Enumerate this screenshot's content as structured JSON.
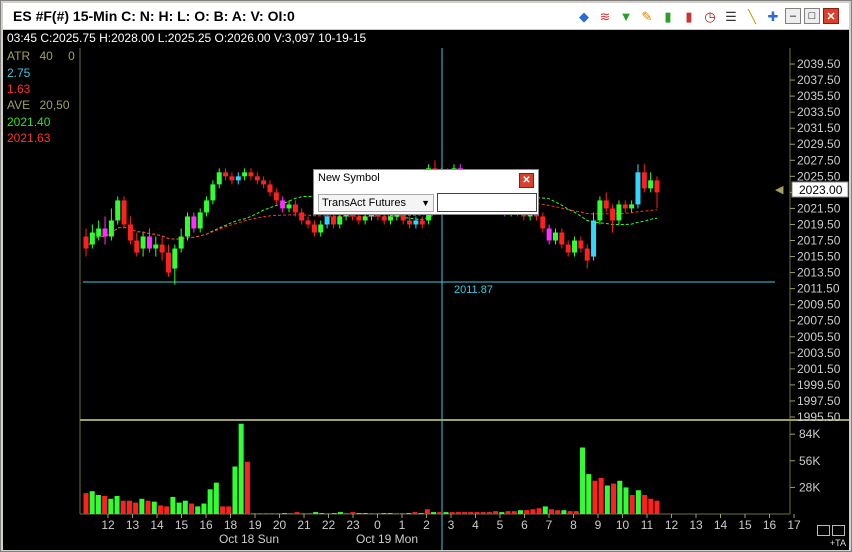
{
  "window": {
    "title": "ES #F(#) 15-Min  C: N: H: L: O: B: A: V: OI:0",
    "toolbar_icons": [
      "diamond-icon",
      "wave-icon",
      "funnel-icon",
      "pencil-icon",
      "bars-icon",
      "candle-icon",
      "clock-icon",
      "list-icon",
      "line-draw-icon",
      "pin-icon"
    ],
    "minimize_label": "–",
    "restore_label": "□",
    "close_label": "✕"
  },
  "infobar": {
    "text": "03:45  C:2025.75  H:2028.00  L:2025.25  O:2026.00  V:3,097  10-19-15"
  },
  "indicators": {
    "atr_label": "ATR",
    "atr_param": "40",
    "atr_extra": "0",
    "atr_val1": "2.75",
    "atr_val2": "1.63",
    "ave_label": "AVE",
    "ave_param": "20,50",
    "ave_val1": "2021.40",
    "ave_val2": "2021.63"
  },
  "price_axis": {
    "labels": [
      "2039.50",
      "2037.50",
      "2035.50",
      "2033.50",
      "2031.50",
      "2029.50",
      "2027.50",
      "2025.50",
      "2023.50",
      "2021.50",
      "2019.50",
      "2017.50",
      "2015.50",
      "2013.50",
      "2011.50",
      "2009.50",
      "2007.50",
      "2005.50",
      "2003.50",
      "2001.50",
      "1999.50",
      "1997.50",
      "1995.50"
    ],
    "current_price": "2023.00",
    "crosshair_price": "2011.87"
  },
  "volume_axis": {
    "labels": [
      "84K",
      "56K",
      "28K"
    ]
  },
  "time_axis": {
    "labels": [
      "12",
      "13",
      "14",
      "15",
      "16",
      "18",
      "19",
      "20",
      "21",
      "22",
      "23",
      "0",
      "1",
      "2",
      "3",
      "4",
      "5",
      "6",
      "7",
      "8",
      "9",
      "10",
      "11",
      "12",
      "13",
      "14",
      "15",
      "16",
      "17"
    ],
    "date_labels": [
      "Oct 18 Sun",
      "Oct 19 Mon"
    ]
  },
  "dialog": {
    "title": "New Symbol",
    "close_label": "✕",
    "select_value": "TransAct Futures",
    "input_value": ""
  },
  "corner": {
    "ta_label": "+TA"
  },
  "chart_data": {
    "type": "candlestick",
    "ylim": [
      1995.5,
      2040.5
    ],
    "candles": [
      {
        "o": 2018.0,
        "c": 2016.5,
        "h": 2019.0,
        "l": 2015.5
      },
      {
        "o": 2017.0,
        "c": 2018.5,
        "h": 2019.5,
        "l": 2016.5
      },
      {
        "o": 2018.0,
        "c": 2019.0,
        "h": 2020.0,
        "l": 2017.5
      },
      {
        "o": 2019.0,
        "c": 2018.0,
        "h": 2020.5,
        "l": 2017.0
      },
      {
        "o": 2018.0,
        "c": 2020.0,
        "h": 2021.5,
        "l": 2017.5
      },
      {
        "o": 2020.0,
        "c": 2022.5,
        "h": 2023.0,
        "l": 2019.5
      },
      {
        "o": 2022.5,
        "c": 2019.5,
        "h": 2023.0,
        "l": 2019.0
      },
      {
        "o": 2019.5,
        "c": 2017.5,
        "h": 2020.5,
        "l": 2017.0
      },
      {
        "o": 2017.5,
        "c": 2016.0,
        "h": 2018.5,
        "l": 2015.5
      },
      {
        "o": 2016.5,
        "c": 2018.0,
        "h": 2018.5,
        "l": 2015.5
      },
      {
        "o": 2018.0,
        "c": 2016.5,
        "h": 2019.0,
        "l": 2016.0
      },
      {
        "o": 2016.5,
        "c": 2017.0,
        "h": 2018.0,
        "l": 2015.5
      },
      {
        "o": 2017.0,
        "c": 2016.0,
        "h": 2018.0,
        "l": 2015.0
      },
      {
        "o": 2016.0,
        "c": 2013.5,
        "h": 2017.0,
        "l": 2013.0
      },
      {
        "o": 2014.0,
        "c": 2016.5,
        "h": 2017.0,
        "l": 2012.0
      },
      {
        "o": 2016.5,
        "c": 2018.0,
        "h": 2019.0,
        "l": 2016.0
      },
      {
        "o": 2018.0,
        "c": 2020.5,
        "h": 2021.0,
        "l": 2017.5
      },
      {
        "o": 2020.5,
        "c": 2019.0,
        "h": 2021.0,
        "l": 2018.5
      },
      {
        "o": 2019.0,
        "c": 2021.0,
        "h": 2021.5,
        "l": 2018.5
      },
      {
        "o": 2021.0,
        "c": 2022.5,
        "h": 2023.0,
        "l": 2020.5
      },
      {
        "o": 2022.5,
        "c": 2024.5,
        "h": 2025.0,
        "l": 2022.0
      },
      {
        "o": 2024.5,
        "c": 2026.0,
        "h": 2026.5,
        "l": 2024.0
      },
      {
        "o": 2026.0,
        "c": 2025.5,
        "h": 2026.5,
        "l": 2025.0
      },
      {
        "o": 2025.5,
        "c": 2025.0,
        "h": 2026.0,
        "l": 2024.5
      },
      {
        "o": 2025.0,
        "c": 2025.5,
        "h": 2026.0,
        "l": 2024.5
      },
      {
        "o": 2025.5,
        "c": 2026.0,
        "h": 2026.5,
        "l": 2025.0
      },
      {
        "o": 2026.0,
        "c": 2025.5,
        "h": 2026.5,
        "l": 2025.0
      },
      {
        "o": 2025.5,
        "c": 2025.0,
        "h": 2026.0,
        "l": 2024.5
      },
      {
        "o": 2025.0,
        "c": 2024.5,
        "h": 2025.5,
        "l": 2024.0
      },
      {
        "o": 2024.5,
        "c": 2023.5,
        "h": 2025.0,
        "l": 2023.0
      },
      {
        "o": 2023.5,
        "c": 2022.5,
        "h": 2024.0,
        "l": 2022.0
      },
      {
        "o": 2022.5,
        "c": 2021.5,
        "h": 2023.0,
        "l": 2021.0
      },
      {
        "o": 2021.5,
        "c": 2022.0,
        "h": 2022.5,
        "l": 2021.0
      },
      {
        "o": 2022.0,
        "c": 2021.0,
        "h": 2022.5,
        "l": 2020.5
      },
      {
        "o": 2021.0,
        "c": 2020.0,
        "h": 2021.5,
        "l": 2019.5
      },
      {
        "o": 2020.0,
        "c": 2019.5,
        "h": 2020.5,
        "l": 2019.0
      },
      {
        "o": 2019.5,
        "c": 2018.5,
        "h": 2020.0,
        "l": 2018.0
      },
      {
        "o": 2018.5,
        "c": 2019.5,
        "h": 2020.0,
        "l": 2018.0
      },
      {
        "o": 2019.5,
        "c": 2020.5,
        "h": 2021.0,
        "l": 2019.0
      },
      {
        "o": 2020.5,
        "c": 2019.5,
        "h": 2021.0,
        "l": 2019.0
      },
      {
        "o": 2019.5,
        "c": 2020.5,
        "h": 2021.0,
        "l": 2019.0
      },
      {
        "o": 2020.5,
        "c": 2021.0,
        "h": 2021.5,
        "l": 2020.0
      },
      {
        "o": 2021.0,
        "c": 2020.5,
        "h": 2021.5,
        "l": 2020.0
      },
      {
        "o": 2020.5,
        "c": 2020.0,
        "h": 2021.0,
        "l": 2019.5
      },
      {
        "o": 2020.0,
        "c": 2020.5,
        "h": 2021.0,
        "l": 2019.5
      },
      {
        "o": 2020.5,
        "c": 2021.0,
        "h": 2021.5,
        "l": 2020.0
      },
      {
        "o": 2021.0,
        "c": 2020.5,
        "h": 2021.5,
        "l": 2020.0
      },
      {
        "o": 2020.5,
        "c": 2020.0,
        "h": 2021.0,
        "l": 2019.5
      },
      {
        "o": 2020.0,
        "c": 2020.5,
        "h": 2021.0,
        "l": 2019.5
      },
      {
        "o": 2020.5,
        "c": 2021.0,
        "h": 2021.5,
        "l": 2020.0
      },
      {
        "o": 2021.0,
        "c": 2020.0,
        "h": 2021.5,
        "l": 2019.5
      },
      {
        "o": 2020.0,
        "c": 2019.5,
        "h": 2020.5,
        "l": 2019.0
      },
      {
        "o": 2019.5,
        "c": 2020.0,
        "h": 2020.5,
        "l": 2019.0
      },
      {
        "o": 2020.0,
        "c": 2019.5,
        "h": 2020.5,
        "l": 2019.0
      },
      {
        "o": 2020.0,
        "c": 2026.5,
        "h": 2027.0,
        "l": 2019.5
      },
      {
        "o": 2026.5,
        "c": 2025.0,
        "h": 2027.5,
        "l": 2024.5
      },
      {
        "o": 2025.0,
        "c": 2026.0,
        "h": 2026.5,
        "l": 2024.5
      },
      {
        "o": 2026.0,
        "c": 2025.0,
        "h": 2026.5,
        "l": 2024.5
      },
      {
        "o": 2025.0,
        "c": 2026.5,
        "h": 2027.0,
        "l": 2024.5
      },
      {
        "o": 2026.5,
        "c": 2025.5,
        "h": 2027.0,
        "l": 2025.0
      },
      {
        "o": 2025.5,
        "c": 2024.5,
        "h": 2026.0,
        "l": 2024.0
      },
      {
        "o": 2024.5,
        "c": 2024.0,
        "h": 2025.0,
        "l": 2023.5
      },
      {
        "o": 2024.0,
        "c": 2023.0,
        "h": 2024.5,
        "l": 2022.5
      },
      {
        "o": 2023.0,
        "c": 2022.5,
        "h": 2023.5,
        "l": 2022.0
      },
      {
        "o": 2022.5,
        "c": 2022.0,
        "h": 2023.0,
        "l": 2021.5
      },
      {
        "o": 2022.0,
        "c": 2021.5,
        "h": 2022.5,
        "l": 2021.0
      },
      {
        "o": 2021.5,
        "c": 2021.0,
        "h": 2022.0,
        "l": 2020.5
      },
      {
        "o": 2021.0,
        "c": 2021.5,
        "h": 2022.0,
        "l": 2020.5
      },
      {
        "o": 2021.5,
        "c": 2021.0,
        "h": 2022.0,
        "l": 2020.5
      },
      {
        "o": 2021.0,
        "c": 2020.5,
        "h": 2021.5,
        "l": 2020.0
      },
      {
        "o": 2020.5,
        "c": 2021.0,
        "h": 2021.5,
        "l": 2020.0
      },
      {
        "o": 2021.0,
        "c": 2020.5,
        "h": 2021.5,
        "l": 2020.0
      },
      {
        "o": 2020.5,
        "c": 2019.0,
        "h": 2021.0,
        "l": 2018.5
      },
      {
        "o": 2019.0,
        "c": 2017.5,
        "h": 2019.5,
        "l": 2017.0
      },
      {
        "o": 2017.5,
        "c": 2018.5,
        "h": 2019.0,
        "l": 2017.0
      },
      {
        "o": 2018.5,
        "c": 2017.0,
        "h": 2019.0,
        "l": 2016.5
      },
      {
        "o": 2017.0,
        "c": 2016.0,
        "h": 2017.5,
        "l": 2015.5
      },
      {
        "o": 2016.0,
        "c": 2017.5,
        "h": 2018.0,
        "l": 2015.5
      },
      {
        "o": 2017.5,
        "c": 2016.5,
        "h": 2018.0,
        "l": 2016.0
      },
      {
        "o": 2016.5,
        "c": 2015.0,
        "h": 2017.0,
        "l": 2014.0
      },
      {
        "o": 2015.5,
        "c": 2020.0,
        "h": 2021.0,
        "l": 2015.0
      },
      {
        "o": 2020.0,
        "c": 2022.5,
        "h": 2023.0,
        "l": 2019.5
      },
      {
        "o": 2022.5,
        "c": 2021.5,
        "h": 2023.5,
        "l": 2021.0
      },
      {
        "o": 2021.5,
        "c": 2020.0,
        "h": 2022.0,
        "l": 2018.5
      },
      {
        "o": 2020.0,
        "c": 2022.0,
        "h": 2022.5,
        "l": 2019.5
      },
      {
        "o": 2022.0,
        "c": 2021.5,
        "h": 2022.5,
        "l": 2021.0
      },
      {
        "o": 2021.5,
        "c": 2022.0,
        "h": 2022.5,
        "l": 2021.0
      },
      {
        "o": 2022.0,
        "c": 2026.0,
        "h": 2027.0,
        "l": 2021.5
      },
      {
        "o": 2026.0,
        "c": 2024.0,
        "h": 2027.0,
        "l": 2023.5
      },
      {
        "o": 2024.0,
        "c": 2025.0,
        "h": 2026.0,
        "l": 2023.5
      },
      {
        "o": 2025.0,
        "c": 2023.5,
        "h": 2025.5,
        "l": 2021.5
      }
    ],
    "volumes": [
      22,
      24,
      20,
      19,
      16,
      19,
      14,
      14,
      12,
      16,
      14,
      13,
      9,
      8,
      18,
      12,
      14,
      11,
      8,
      11,
      26,
      33,
      8,
      8,
      50,
      95,
      55,
      1,
      1,
      1,
      1,
      1,
      1,
      1,
      2,
      1,
      1,
      2,
      1,
      1,
      1,
      2,
      1,
      2,
      1,
      1,
      1,
      1,
      1,
      1,
      1,
      1,
      1,
      2,
      1,
      5,
      2,
      2,
      2,
      2,
      2,
      2,
      2,
      2,
      2,
      2,
      3,
      2,
      3,
      3,
      4,
      4,
      5,
      6,
      8,
      5,
      4,
      4,
      3,
      3,
      70,
      42,
      35,
      38,
      30,
      32,
      35,
      28,
      20,
      25,
      20,
      16,
      14
    ]
  }
}
